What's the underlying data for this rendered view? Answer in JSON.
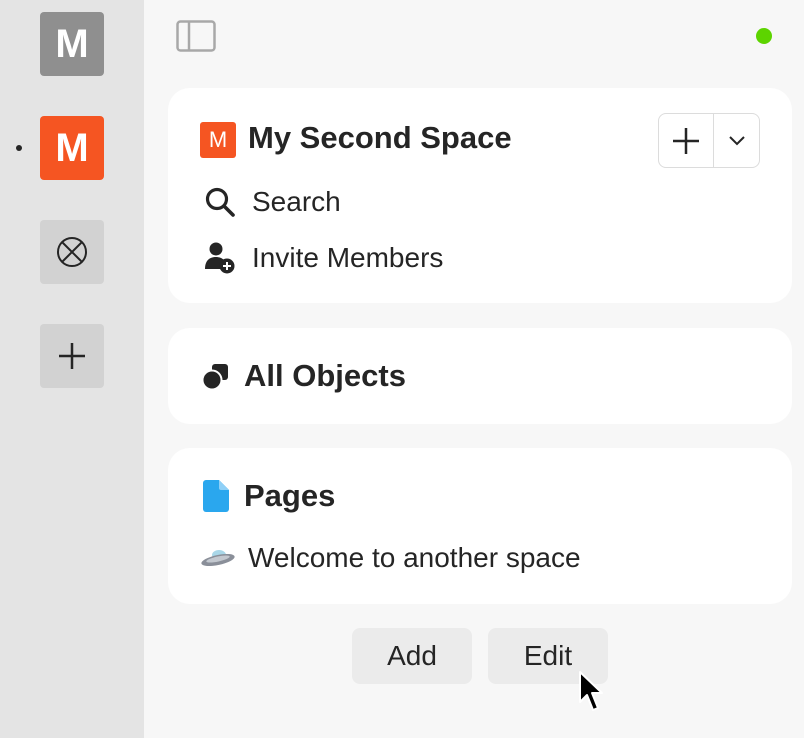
{
  "rail": {
    "spaces": [
      {
        "letter": "M",
        "color": "#8f8f8f",
        "icon": ""
      },
      {
        "letter": "M",
        "color": "#f55522",
        "icon": "",
        "active": true
      },
      {
        "letter": "",
        "color": "#d2d2d2",
        "icon": "circle-x-icon"
      },
      {
        "letter": "",
        "color": "#d2d2d2",
        "icon": "plus-icon"
      }
    ]
  },
  "header": {
    "sidebar_toggle_icon": "sidebar-toggle-icon",
    "status_color": "#5dd400"
  },
  "space_card": {
    "icon_letter": "M",
    "title": "My Second Space",
    "items": [
      {
        "label": "Search",
        "icon": "search-icon"
      },
      {
        "label": "Invite Members",
        "icon": "add-member-icon"
      }
    ]
  },
  "objects_card": {
    "title": "All Objects",
    "icon": "objects-icon"
  },
  "pages_card": {
    "title": "Pages",
    "icon": "page-icon",
    "items": [
      {
        "label": "Welcome to another space",
        "icon": "ufo-icon"
      }
    ]
  },
  "actions": {
    "add_label": "Add",
    "edit_label": "Edit"
  }
}
